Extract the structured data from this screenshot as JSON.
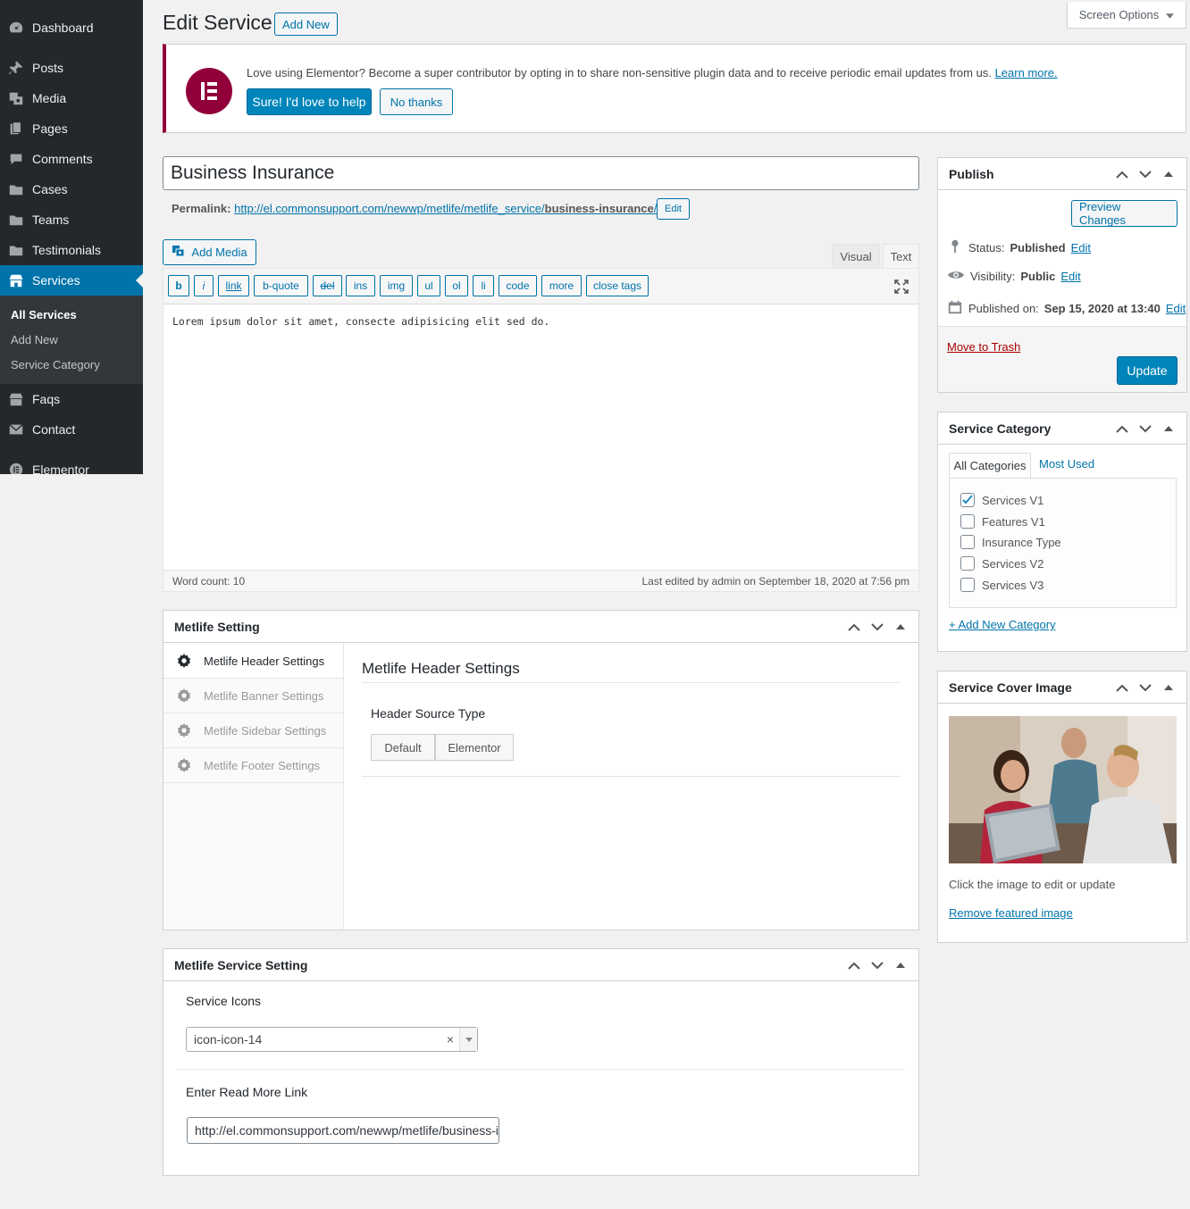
{
  "sidebar": {
    "items": [
      {
        "label": "Dashboard",
        "icon": "dashboard-icon"
      },
      {
        "label": "Posts",
        "icon": "pin-icon"
      },
      {
        "label": "Media",
        "icon": "media-icon"
      },
      {
        "label": "Pages",
        "icon": "pages-icon"
      },
      {
        "label": "Comments",
        "icon": "comments-icon"
      },
      {
        "label": "Cases",
        "icon": "folder-icon"
      },
      {
        "label": "Teams",
        "icon": "folder-icon"
      },
      {
        "label": "Testimonials",
        "icon": "folder-icon"
      },
      {
        "label": "Services",
        "icon": "store-icon"
      },
      {
        "label": "Faqs",
        "icon": "store-icon"
      },
      {
        "label": "Contact",
        "icon": "email-icon"
      },
      {
        "label": "Elementor",
        "icon": "elementor-icon"
      }
    ],
    "submenu": [
      "All Services",
      "Add New",
      "Service Category"
    ]
  },
  "header": {
    "title": "Edit Service",
    "add_new": "Add New",
    "screen_options": "Screen Options"
  },
  "notice": {
    "text": "Love using Elementor? Become a super contributor by opting in to share non-sensitive plugin data and to receive periodic email updates from us.",
    "learn_more": "Learn more.",
    "accept": "Sure! I'd love to help",
    "decline": "No thanks"
  },
  "post": {
    "title": "Business Insurance",
    "permalink_label": "Permalink:",
    "permalink_base": "http://el.commonsupport.com/newwp/metlife/metlife_service/",
    "permalink_slug": "business-insurance",
    "permalink_tail": "/",
    "edit": "Edit"
  },
  "editor": {
    "add_media": "Add Media",
    "tab_visual": "Visual",
    "tab_text": "Text",
    "buttons": [
      "b",
      "i",
      "link",
      "b-quote",
      "del",
      "ins",
      "img",
      "ul",
      "ol",
      "li",
      "code",
      "more",
      "close tags"
    ],
    "content": "Lorem ipsum dolor sit amet, consecte adipisicing elit sed do.",
    "word_count": "Word count: 10",
    "last_edited": "Last edited by admin on September 18, 2020 at 7:56 pm"
  },
  "metlife_setting": {
    "title": "Metlife Setting",
    "tabs": [
      "Metlife Header Settings",
      "Metlife Banner Settings",
      "Metlife Sidebar Settings",
      "Metlife Footer Settings"
    ],
    "panel_title": "Metlife Header Settings",
    "field_label": "Header Source Type",
    "options": [
      "Default",
      "Elementor"
    ]
  },
  "service_setting": {
    "title": "Metlife Service Setting",
    "icons_label": "Service Icons",
    "icon_value": "icon-icon-14",
    "link_label": "Enter Read More Link",
    "link_value": "http://el.commonsupport.com/newwp/metlife/business-insurance/"
  },
  "publish": {
    "title": "Publish",
    "preview": "Preview Changes",
    "status_label": "Status:",
    "status_value": "Published",
    "visibility_label": "Visibility:",
    "visibility_value": "Public",
    "published_label": "Published on:",
    "published_value": "Sep 15, 2020 at 13:40",
    "edit": "Edit",
    "trash": "Move to Trash",
    "update": "Update"
  },
  "category": {
    "title": "Service Category",
    "tab_all": "All Categories",
    "tab_used": "Most Used",
    "items": [
      {
        "label": "Services V1",
        "checked": true
      },
      {
        "label": "Features V1",
        "checked": false
      },
      {
        "label": "Insurance Type",
        "checked": false
      },
      {
        "label": "Services V2",
        "checked": false
      },
      {
        "label": "Services V3",
        "checked": false
      }
    ],
    "add_new": "+ Add New Category"
  },
  "cover": {
    "title": "Service Cover Image",
    "hint": "Click the image to edit or update",
    "remove": "Remove featured image"
  },
  "colors": {
    "admin_bg": "#23282d",
    "accent": "#0073aa",
    "elementor": "#92003b",
    "primary_button": "#0085ba"
  }
}
